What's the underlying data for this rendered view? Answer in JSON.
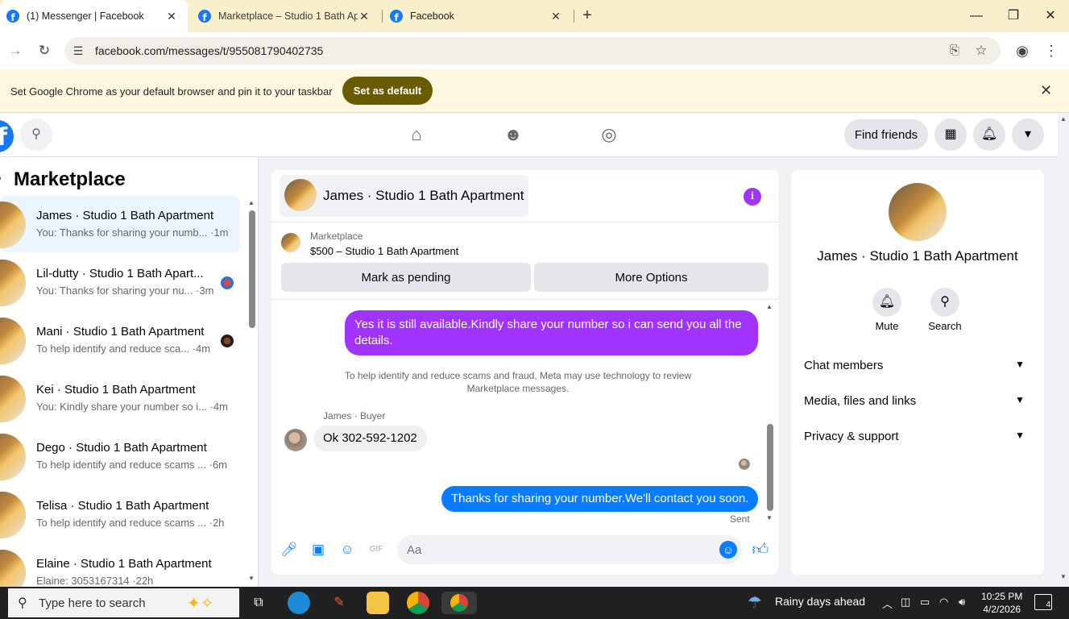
{
  "browser": {
    "tabs": [
      {
        "title": "(1) Messenger | Facebook",
        "active": true
      },
      {
        "title": "Marketplace – Studio 1 Bath Ap",
        "active": false
      },
      {
        "title": "Facebook",
        "active": false
      }
    ],
    "url": "facebook.com/messages/t/955081790402735",
    "infobar": {
      "message": "Set Google Chrome as your default browser and pin it to your taskbar",
      "button": "Set as default"
    }
  },
  "fb_header": {
    "find_friends": "Find friends"
  },
  "chat_list": {
    "title": "Marketplace",
    "items": [
      {
        "name": "James · Studio 1 Bath Apartment",
        "preview": "You: Thanks for sharing your numb... ·1m",
        "selected": true
      },
      {
        "name": "Lil-dutty · Studio 1 Bath Apart...",
        "preview": "You: Thanks for sharing your nu... ·3m",
        "selected": false
      },
      {
        "name": "Mani · Studio 1 Bath Apartment",
        "preview": "To help identify and reduce sca... ·4m",
        "selected": false
      },
      {
        "name": "Kei · Studio 1 Bath Apartment",
        "preview": "You: Kindly share your number so i... ·4m",
        "selected": false
      },
      {
        "name": "Dego · Studio 1 Bath Apartment",
        "preview": "To help identify and reduce scams ... ·6m",
        "selected": false
      },
      {
        "name": "Telisa · Studio 1 Bath Apartment",
        "preview": "To help identify and reduce scams ... ·2h",
        "selected": false
      },
      {
        "name": "Elaine · Studio 1 Bath Apartment",
        "preview": "Elaine: 3053167314 ·22h",
        "selected": false
      }
    ]
  },
  "conversation": {
    "title": "James · Studio 1 Bath Apartment",
    "listing_source": "Marketplace",
    "listing_title": "$500 – Studio 1 Bath Apartment",
    "mark_pending": "Mark as pending",
    "more_options": "More Options",
    "messages": {
      "out_1": "Yes it is still available.Kindly share your number so i can send you all the details.",
      "notice": "To help identify and reduce scams and fraud, Meta may use technology to review Marketplace messages.",
      "sender_label": "James · Buyer",
      "in_1": "Ok 302-592-1202",
      "out_2": "Thanks for sharing your number.We'll contact you soon.",
      "status": "Sent"
    },
    "composer_placeholder": "Aa"
  },
  "info_panel": {
    "name": "James · Studio 1 Bath Apartment",
    "mute": "Mute",
    "search": "Search",
    "sections": [
      "Chat members",
      "Media, files and links",
      "Privacy & support"
    ]
  },
  "taskbar": {
    "search_placeholder": "Type here to search",
    "weather": "Rainy days ahead",
    "time": "10:25 PM",
    "date": "4/2/2026",
    "notifications": "4"
  },
  "colors": {
    "messenger_purple": "#a033ff",
    "messenger_blue": "#0a7cff",
    "facebook_blue": "#1877f2"
  }
}
